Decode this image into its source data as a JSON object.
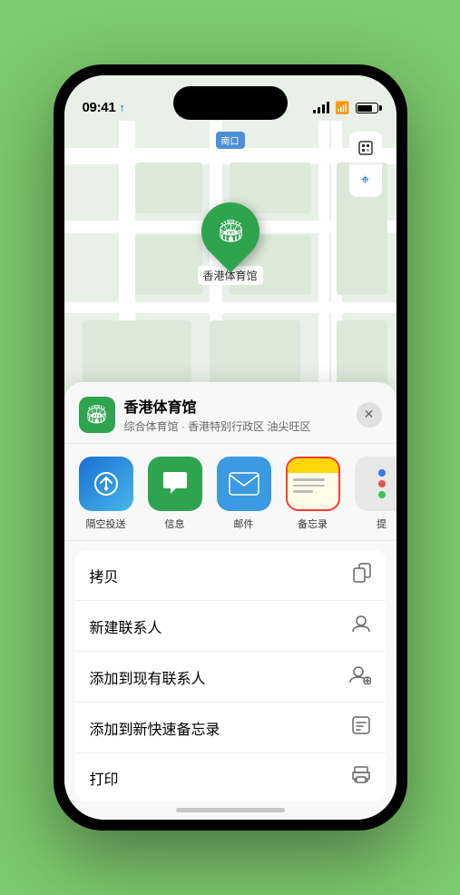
{
  "status": {
    "time": "09:41",
    "location_arrow": "▲"
  },
  "map": {
    "label": "南口"
  },
  "place": {
    "name": "香港体育馆",
    "description": "综合体育馆 · 香港特别行政区 油尖旺区",
    "pin_label": "香港体育馆"
  },
  "share_items": [
    {
      "label": "隔空投送",
      "type": "airdrop"
    },
    {
      "label": "信息",
      "type": "message"
    },
    {
      "label": "邮件",
      "type": "mail"
    },
    {
      "label": "备忘录",
      "type": "notes"
    },
    {
      "label": "提",
      "type": "more"
    }
  ],
  "actions": [
    {
      "label": "拷贝",
      "icon": "📋"
    },
    {
      "label": "新建联系人",
      "icon": "👤"
    },
    {
      "label": "添加到现有联系人",
      "icon": "👤"
    },
    {
      "label": "添加到新快速备忘录",
      "icon": "📝"
    },
    {
      "label": "打印",
      "icon": "🖨"
    }
  ]
}
